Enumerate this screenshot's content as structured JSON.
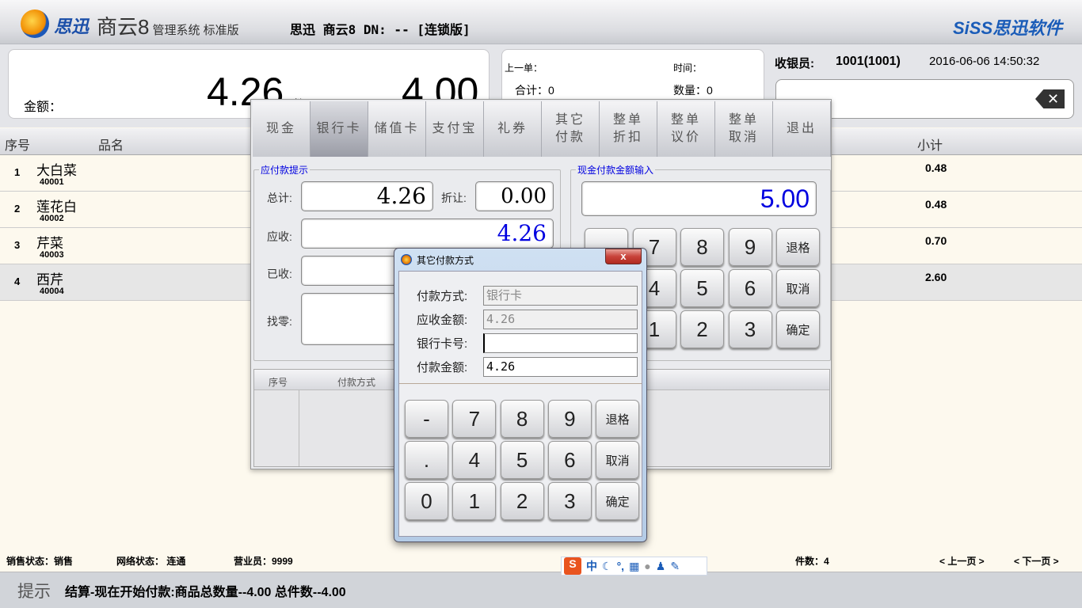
{
  "header": {
    "brand": "思迅",
    "product": "商云8",
    "product_sub": "管理系统 标准版",
    "window_title": "思迅 商云8 DN: -- [连锁版]",
    "right_logo": "SiSS思迅软件"
  },
  "amount": {
    "amount_label": "金额：",
    "amount_value": "4.26",
    "qty_label": "数量",
    "qty_value": "4.00"
  },
  "last_order": {
    "last_label": "上一单：",
    "time_label": "时间：",
    "total_label": "合计：0",
    "qty_label": "数量：0"
  },
  "cashier": {
    "label": "收银员:",
    "id": "1001(1001)",
    "datetime": "2016-06-06 14:50:32",
    "input_value": "",
    "backspace_icon": "backspace-icon"
  },
  "table": {
    "headers": [
      "序号",
      "品名",
      "小计"
    ],
    "rows": [
      {
        "no": "1",
        "name": "大白菜",
        "code": "40001",
        "subtotal": "0.48"
      },
      {
        "no": "2",
        "name": "莲花白",
        "code": "40002",
        "subtotal": "0.48"
      },
      {
        "no": "3",
        "name": "芹菜",
        "code": "40003",
        "subtotal": "0.70"
      },
      {
        "no": "4",
        "name": "西芹",
        "code": "40004",
        "subtotal": "2.60"
      }
    ]
  },
  "status": {
    "sale": "销售状态：销售",
    "network": "网络状态：  连通",
    "clerk": "营业员：9999",
    "count": "件数：4",
    "prev": "< 上一页 >",
    "next": "< 下一页 >"
  },
  "tip": {
    "label": "提示",
    "text": "结算-现在开始付款:商品总数量--4.00 总件数--4.00"
  },
  "payment": {
    "toolbar": [
      "现金",
      "银行卡",
      "储值卡",
      "支付宝",
      "礼券",
      "其它\n付款",
      "整单\n折扣",
      "整单\n议价",
      "整单\n取消",
      "退出"
    ],
    "selected": "银行卡",
    "hint_legend": "应付款提示",
    "total_label": "总计:",
    "total": "4.26",
    "discount_label": "折让:",
    "discount": "0.00",
    "due_label": "应收:",
    "due": "4.26",
    "received_label": "已收:",
    "change_label": "找零:",
    "cash_legend": "现金付款金额输入",
    "cash_input": "5.00",
    "keypad": [
      "-",
      "7",
      "8",
      "9",
      "退格",
      ".",
      "4",
      "5",
      "6",
      "取消",
      "0",
      "1",
      "2",
      "3",
      "确定"
    ],
    "list_headers": [
      "序号",
      "付款方式"
    ]
  },
  "dialog": {
    "title": "其它付款方式",
    "close": "x",
    "fields": [
      {
        "label": "付款方式:",
        "value": "银行卡",
        "readonly": true
      },
      {
        "label": "应收金额:",
        "value": "4.26",
        "readonly": true
      },
      {
        "label": "银行卡号:",
        "value": "",
        "readonly": false
      },
      {
        "label": "付款金额:",
        "value": "4.26",
        "readonly": false
      }
    ],
    "keypad": [
      "-",
      "7",
      "8",
      "9",
      "退格",
      ".",
      "4",
      "5",
      "6",
      "取消",
      "0",
      "1",
      "2",
      "3",
      "确定"
    ]
  },
  "ime": {
    "label": "中",
    "icons": [
      "sogou-icon",
      "moon-icon",
      "punctuation-icon",
      "keyboard-icon",
      "user-icon",
      "shirt-icon",
      "wrench-icon"
    ]
  },
  "colors": {
    "accent_blue": "#0000e0",
    "close_red": "#c8423a"
  }
}
